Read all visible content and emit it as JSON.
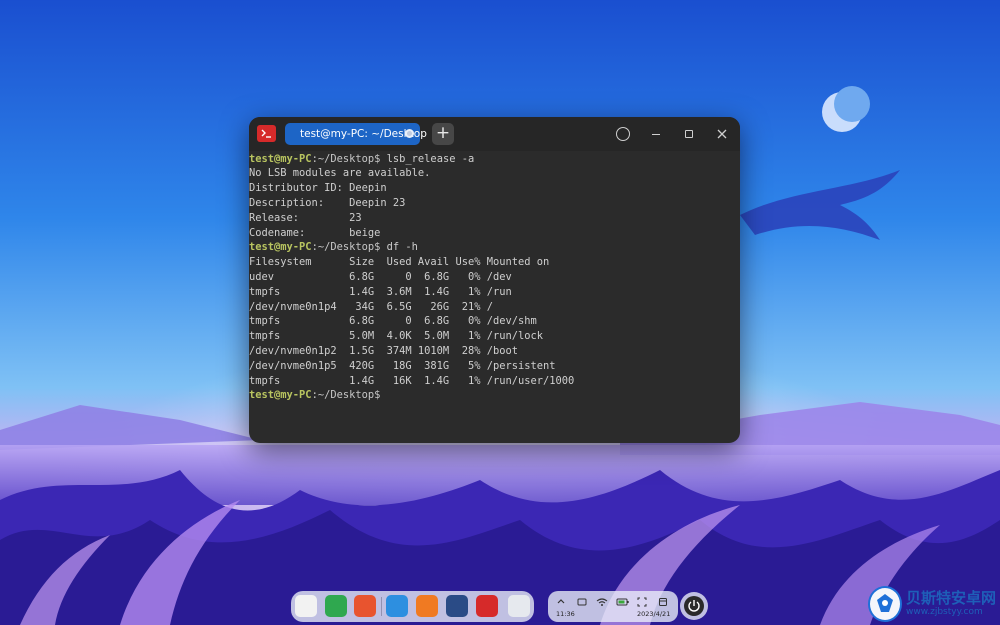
{
  "terminal": {
    "tab_label": "test@my-PC: ~/Desktop",
    "new_tab_symbol": "+",
    "lines": [
      {
        "user": "test@my-PC",
        "path": ":~/Desktop$",
        "text": " lsb_release -a"
      },
      {
        "text": "No LSB modules are available."
      },
      {
        "text": "Distributor ID: Deepin"
      },
      {
        "text": "Description:    Deepin 23"
      },
      {
        "text": "Release:        23"
      },
      {
        "text": "Codename:       beige"
      },
      {
        "user": "test@my-PC",
        "path": ":~/Desktop$",
        "text": " df -h"
      },
      {
        "text": "Filesystem      Size  Used Avail Use% Mounted on"
      },
      {
        "text": "udev            6.8G     0  6.8G   0% /dev"
      },
      {
        "text": "tmpfs           1.4G  3.6M  1.4G   1% /run"
      },
      {
        "text": "/dev/nvme0n1p4   34G  6.5G   26G  21% /"
      },
      {
        "text": "tmpfs           6.8G     0  6.8G   0% /dev/shm"
      },
      {
        "text": "tmpfs           5.0M  4.0K  5.0M   1% /run/lock"
      },
      {
        "text": "/dev/nvme0n1p2  1.5G  374M 1010M  28% /boot"
      },
      {
        "text": "/dev/nvme0n1p5  420G   18G  381G   5% /persistent"
      },
      {
        "text": "tmpfs           1.4G   16K  1.4G   1% /run/user/1000"
      },
      {
        "user": "test@my-PC",
        "path": ":~/Desktop$",
        "text": ""
      }
    ]
  },
  "dock": {
    "icons": [
      {
        "name": "launcher-icon",
        "color": "#f2f2f2"
      },
      {
        "name": "file-manager-icon",
        "color": "#2fa84f"
      },
      {
        "name": "multitask-view-icon",
        "color": "#e8542f"
      },
      {
        "name": "app-store-icon",
        "color": "#2d8fe0"
      },
      {
        "name": "archive-icon",
        "color": "#f07a22"
      },
      {
        "name": "settings-icon",
        "color": "#2a4b86"
      },
      {
        "name": "terminal-icon",
        "color": "#d62a2a"
      },
      {
        "name": "trash-icon",
        "color": "#e6e9ee"
      }
    ]
  },
  "tray": {
    "time": "11:36",
    "date": "2023/4/21"
  },
  "watermark": {
    "title": "贝斯特安卓网",
    "url": "www.zjbstyy.com"
  },
  "colors": {
    "tab_active": "#1d65c6",
    "prompt_user": "#b9c560",
    "terminal_bg": "#2b2b2b"
  }
}
